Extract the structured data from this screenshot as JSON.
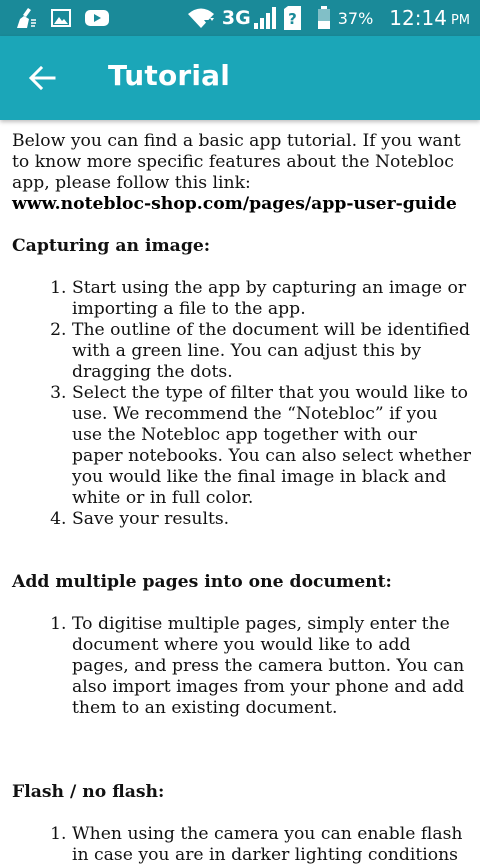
{
  "status_bar": {
    "network": "3G",
    "battery": "37%",
    "time": "12:14",
    "ampm": "PM",
    "left_icons": [
      "cleaner-broom-icon",
      "gallery-icon",
      "youtube-icon"
    ],
    "right_icons": [
      "wifi-icon",
      "signal-icon",
      "unknown-sim-icon",
      "battery-icon"
    ]
  },
  "app_bar": {
    "title": "Tutorial",
    "back_icon": "arrow-back-icon"
  },
  "tutorial": {
    "intro": "Below you can find a basic app tutorial. If you want to know more specific features about the Notebloc app, please follow this link:",
    "link": "www.notebloc-shop.com/pages/app-user-guide",
    "sections": [
      {
        "heading": "Capturing an image:",
        "steps": [
          "Start using the app by capturing an image or importing a file to the app.",
          "The outline of the document will be identified with a green line. You can adjust this by dragging the dots.",
          "Select the type of filter that you would like to use. We recommend the “Notebloc” if you use the Notebloc app together with our paper notebooks. You can also select whether you would like the final image in black and white or in full color.",
          "Save your results."
        ]
      },
      {
        "heading": "Add multiple pages into one document:",
        "steps": [
          "To digitise multiple pages, simply enter the document where you would like to add pages, and press the camera button. You can also import images from your phone and add them to an existing document."
        ]
      },
      {
        "heading": "Flash / no flash:",
        "steps": [
          "When using the camera you can enable flash in case you are in darker lighting conditions"
        ]
      }
    ]
  },
  "colors": {
    "status_bar": "#1a8a99",
    "app_bar": "#1ba6b8",
    "text": "#111111"
  }
}
